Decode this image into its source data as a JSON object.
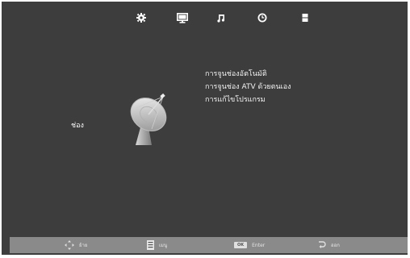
{
  "topbar": {
    "icons": [
      "gear-icon",
      "monitor-icon",
      "music-note-icon",
      "clock-icon",
      "lock-icon"
    ]
  },
  "left_label": "ช่อง",
  "menu": {
    "items": [
      "การจูนช่องอัตโนมัติ",
      "การจูนช่อง ATV ด้วยตนเอง",
      "การแก้ไขโปรแกรม"
    ]
  },
  "bottom": {
    "move_label": "ย้าย",
    "menu_label": "เมนู",
    "ok_badge": "OK",
    "enter_label": "Enter",
    "exit_label": "ออก"
  }
}
